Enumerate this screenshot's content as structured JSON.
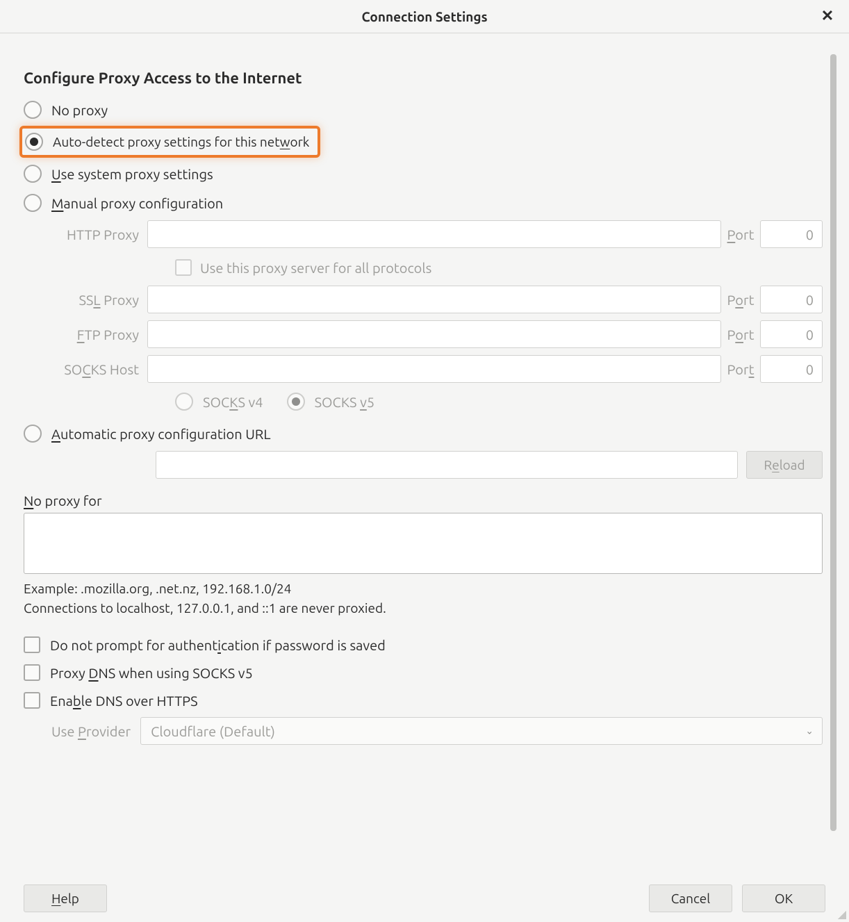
{
  "titlebar": {
    "title": "Connection Settings",
    "close_glyph": "✕"
  },
  "heading": "Configure Proxy Access to the Internet",
  "radios": {
    "no_proxy": "No proxy",
    "auto_detect_pre": "Auto-detect proxy settings for this net",
    "auto_detect_u": "w",
    "auto_detect_post": "ork",
    "system_u": "U",
    "system_post": "se system proxy settings",
    "manual_u": "M",
    "manual_post": "anual proxy configuration",
    "pac_u": "A",
    "pac_post": "utomatic proxy configuration URL"
  },
  "manual": {
    "http_label": "HTTP Proxy",
    "http_value": "",
    "use_all_label": "Use this proxy server for all protocols",
    "ssl_label_pre": "SS",
    "ssl_label_u": "L",
    "ssl_label_post": " Proxy",
    "ssl_value": "",
    "ftp_label_u": "F",
    "ftp_label_post": "TP Proxy",
    "ftp_value": "",
    "socks_label_pre": "SO",
    "socks_label_u": "C",
    "socks_label_post": "KS Host",
    "socks_value": "",
    "port_label_u": "P",
    "port_label_post": "ort",
    "port_label_plain_pre": "P",
    "port_label_plain_u": "o",
    "port_label_plain_post": "rt",
    "port_label_plain2": "Por",
    "port_label_plain2_u": "t",
    "http_port": "0",
    "ssl_port": "0",
    "ftp_port": "0",
    "socks_port": "0",
    "socks_v4_pre": "SOC",
    "socks_v4_u": "K",
    "socks_v4_post": "S v4",
    "socks_v5_pre": "SOCKS ",
    "socks_v5_u": "v",
    "socks_v5_post": "5"
  },
  "pac": {
    "url_value": "",
    "reload_pre": "R",
    "reload_u": "e",
    "reload_post": "load"
  },
  "noproxy": {
    "label_u": "N",
    "label_post": "o proxy for",
    "value": "",
    "example": "Example: .mozilla.org, .net.nz, 192.168.1.0/24",
    "note": "Connections to localhost, 127.0.0.1, and ::1 are never proxied."
  },
  "options": {
    "no_prompt_pre": "Do not prompt for authent",
    "no_prompt_u": "i",
    "no_prompt_post": "cation if password is saved",
    "proxy_dns_pre": "Proxy ",
    "proxy_dns_u": "D",
    "proxy_dns_post": "NS when using SOCKS v5",
    "enable_doh_pre": "Ena",
    "enable_doh_u": "b",
    "enable_doh_post": "le DNS over HTTPS",
    "provider_label_pre": "Use ",
    "provider_label_u": "P",
    "provider_label_post": "rovider",
    "provider_value": "Cloudflare (Default)"
  },
  "footer": {
    "help_u": "H",
    "help_post": "elp",
    "cancel": "Cancel",
    "ok": "OK"
  }
}
